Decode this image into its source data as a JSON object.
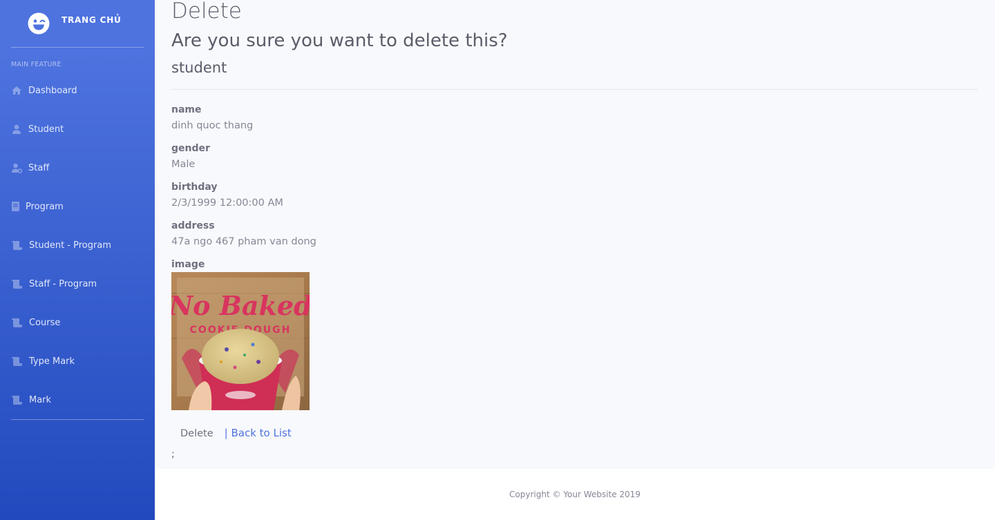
{
  "sidebar": {
    "brand": {
      "text": "TRANG CHỦ",
      "icon": "laugh-wink-icon"
    },
    "heading": "MAIN FEATURE",
    "items": [
      {
        "label": "Dashboard",
        "icon": "home-icon"
      },
      {
        "label": "Student",
        "icon": "user-icon"
      },
      {
        "label": "Staff",
        "icon": "user-cog-icon"
      },
      {
        "label": "Program",
        "icon": "book-icon"
      },
      {
        "label": "Student - Program",
        "icon": "scroll-icon"
      },
      {
        "label": "Staff - Program",
        "icon": "scroll-icon"
      },
      {
        "label": "Course",
        "icon": "scroll-icon"
      },
      {
        "label": "Type Mark",
        "icon": "scroll-icon"
      },
      {
        "label": "Mark",
        "icon": "scroll-icon"
      }
    ],
    "colors": {
      "gradient_top": "#4e73df",
      "gradient_bottom": "#224abe"
    }
  },
  "page": {
    "title": "Delete",
    "confirm_question": "Are you sure you want to delete this?",
    "entity": "student"
  },
  "details": {
    "name": {
      "label": "name",
      "value": "dinh quoc thang"
    },
    "gender": {
      "label": "gender",
      "value": "Male"
    },
    "birthday": {
      "label": "birthday",
      "value": "2/3/1999 12:00:00 AM"
    },
    "address": {
      "label": "address",
      "value": "47a ngo 467 pham van dong"
    },
    "image": {
      "label": "image",
      "image_text": "No Baked",
      "image_subtext": "COOKIE DOUGH"
    }
  },
  "actions": {
    "delete_label": "Delete",
    "back_label": "| Back to List",
    "trailing_text": ";"
  },
  "footer": {
    "copyright": "Copyright © Your Website 2019"
  }
}
